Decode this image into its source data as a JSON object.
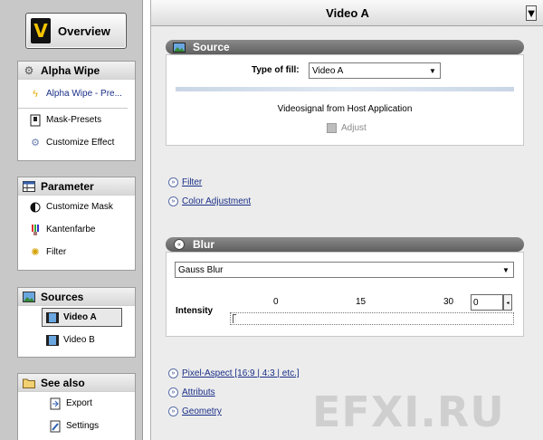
{
  "overview": {
    "label": "Overview",
    "logo_letter": "V"
  },
  "groups": {
    "alpha": {
      "title": "Alpha Wipe",
      "items": [
        {
          "label": "Alpha Wipe - Pre..."
        },
        {
          "label": "Mask-Presets"
        },
        {
          "label": "Customize Effect"
        }
      ]
    },
    "parameter": {
      "title": "Parameter",
      "items": [
        {
          "label": "Customize Mask"
        },
        {
          "label": "Kantenfarbe"
        },
        {
          "label": "Filter"
        }
      ]
    },
    "sources": {
      "title": "Sources",
      "items": [
        {
          "label": "Video A"
        },
        {
          "label": "Video B"
        }
      ]
    },
    "seealso": {
      "title": "See also",
      "items": [
        {
          "label": "Export"
        },
        {
          "label": "Settings"
        }
      ]
    }
  },
  "main": {
    "title": "Video A",
    "source": {
      "title": "Source",
      "fill_label": "Type of fill:",
      "fill_value": "Video A",
      "description": "Videosignal from Host Application",
      "adjust_label": "Adjust"
    },
    "links_top": [
      {
        "label": "Filter"
      },
      {
        "label": "Color Adjustment"
      }
    ],
    "blur": {
      "title": "Blur",
      "type_value": "Gauss Blur",
      "intensity_label": "Intensity",
      "ticks": [
        "0",
        "15",
        "30"
      ],
      "intensity_value": "0"
    },
    "links_bottom": [
      {
        "label": "Pixel-Aspect [16:9 | 4:3 | etc.]"
      },
      {
        "label": "Attributs"
      },
      {
        "label": "Geometry"
      }
    ]
  },
  "watermark": "EFXI.RU",
  "colors": {
    "panel_bg": "#c8c8c8",
    "main_bg": "#ececec",
    "section_header": "#6f6f6f",
    "link": "#1a2f88",
    "logo_yellow": "#f5c400"
  }
}
